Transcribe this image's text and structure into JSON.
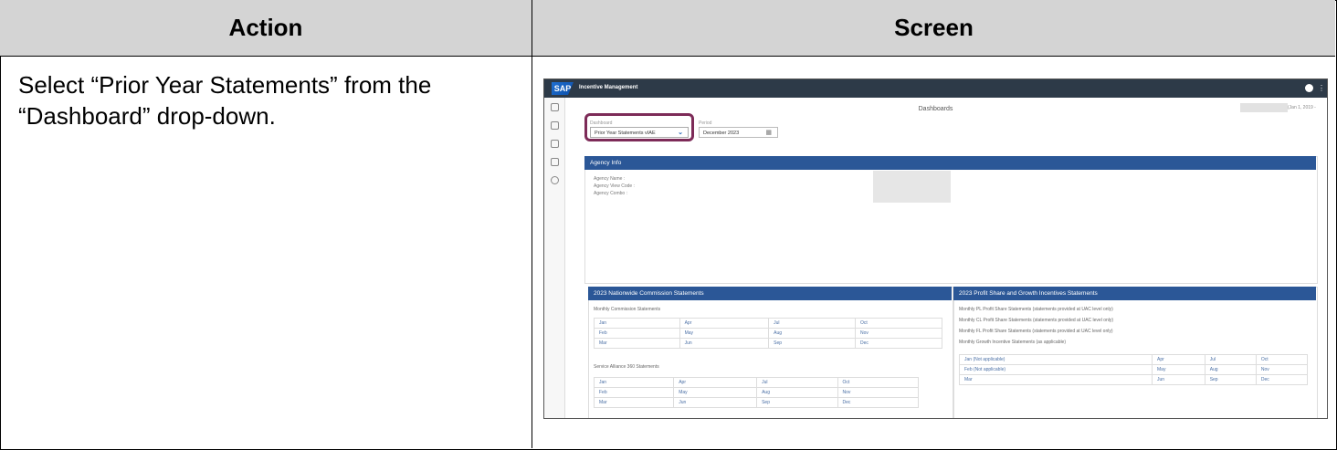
{
  "headers": {
    "action": "Action",
    "screen": "Screen"
  },
  "instruction": "Select “Prior Year Statements” from the “Dashboard” drop-down.",
  "app": {
    "logo": "SAP",
    "title": "Incentive Management",
    "page_title": "Dashboards",
    "user_date": "(Jan 1, 2019 -",
    "dashboard_label": "Dashboard",
    "dashboard_value": "Prior Year Statements vIAE",
    "period_label": "Period",
    "period_value": "December 2023",
    "highlight_color": "#7d2b58",
    "header_color": "#2b5797"
  },
  "agency": {
    "title": "Agency Info",
    "name_label": "Agency Name :",
    "view_code_label": "Agency View Code :",
    "combo_label": "Agency Combo :"
  },
  "commission": {
    "title": "2023 Nationwide Commission Statements",
    "monthly_label": "Monthly Commission Statements",
    "monthly_rows": [
      [
        "Jan",
        "Apr",
        "Jul",
        "Oct"
      ],
      [
        "Feb",
        "May",
        "Aug",
        "Nov"
      ],
      [
        "Mar",
        "Jun",
        "Sep",
        "Dec"
      ]
    ],
    "alliance_label": "Service Alliance 360 Statements",
    "alliance_rows": [
      [
        "Jan",
        "Apr",
        "Jul",
        "Oct"
      ],
      [
        "Feb",
        "May",
        "Aug",
        "Nov"
      ],
      [
        "Mar",
        "Jun",
        "Sep",
        "Dec"
      ]
    ]
  },
  "profit": {
    "title": "2023 Profit Share and Growth Incentives Statements",
    "items": [
      "Monthly PL Profit Share Statements (statements provided at UAC level only)",
      "Monthly CL Profit Share Statements (statements provided at UAC level only)",
      "Monthly FL Profit Share Statements (statements provided at UAC level only)",
      "Monthly Growth Incentive Statements (as applicable)"
    ],
    "rows": [
      [
        "Jan (Not applicable)",
        "Apr",
        "Jul",
        "Oct"
      ],
      [
        "Feb (Not applicable)",
        "May",
        "Aug",
        "Nov"
      ],
      [
        "Mar",
        "Jun",
        "Sep",
        "Dec"
      ]
    ]
  }
}
